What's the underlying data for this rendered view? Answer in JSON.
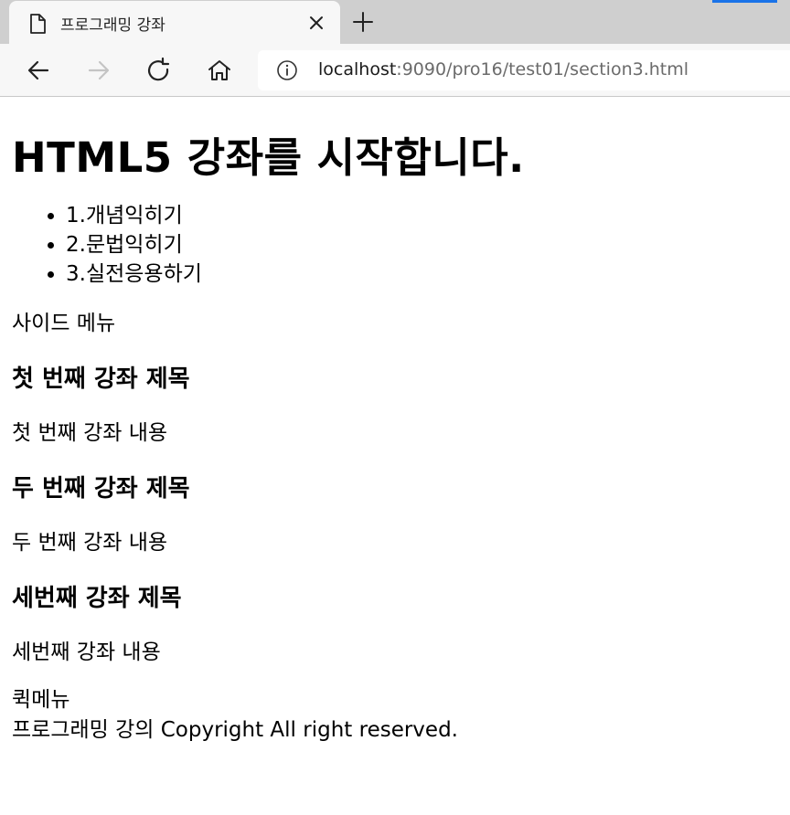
{
  "browser": {
    "tab_title": "프로그래밍 강좌",
    "url_host": "localhost",
    "url_path": ":9090/pro16/test01/section3.html",
    "accent_color": "#1a73e8"
  },
  "page": {
    "title": "HTML5 강좌를 시작합니다.",
    "nav": [
      "1.개념익히기",
      "2.문법익히기",
      "3.실전응용하기"
    ],
    "side_menu": "사이드 메뉴",
    "lectures": [
      {
        "title": "첫 번째 강좌 제목",
        "body": "첫 번째 강좌 내용"
      },
      {
        "title": "두 번째 강좌 제목",
        "body": "두 번째 강좌 내용"
      },
      {
        "title": "세번째 강좌 제목",
        "body": "세번째 강좌 내용"
      }
    ],
    "quick_menu": "퀵메뉴",
    "footer": "프로그래밍 강의 Copyright All right reserved."
  },
  "icons": {
    "tab": "page-icon",
    "close": "close-icon",
    "new_tab": "plus-icon",
    "back": "back-arrow-icon",
    "forward": "forward-arrow-icon",
    "reload": "reload-icon",
    "home": "home-icon",
    "info": "info-icon"
  }
}
